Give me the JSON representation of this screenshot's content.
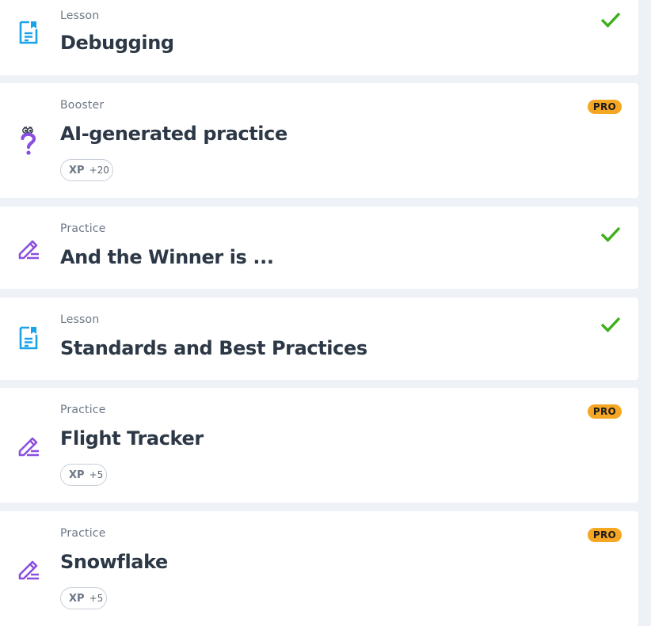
{
  "colors": {
    "background": "#eef2f6",
    "lesson_icon": "#1aa3e8",
    "practice_icon": "#8a4fe0",
    "check": "#3cb01a",
    "pro_badge": "#f5a623"
  },
  "items": [
    {
      "kind": "Lesson",
      "title": "Debugging",
      "icon": "lesson-doc-icon",
      "status": "completed"
    },
    {
      "kind": "Booster",
      "title": "AI-generated practice",
      "icon": "question-mark-icon",
      "badge": "PRO",
      "xp_label": "XP",
      "xp_value": "+20"
    },
    {
      "kind": "Practice",
      "title": "And the Winner is ...",
      "icon": "pencil-icon",
      "status": "completed"
    },
    {
      "kind": "Lesson",
      "title": "Standards and Best Practices",
      "icon": "lesson-doc-icon",
      "status": "completed"
    },
    {
      "kind": "Practice",
      "title": "Flight Tracker",
      "icon": "pencil-icon",
      "badge": "PRO",
      "xp_label": "XP",
      "xp_value": "+5"
    },
    {
      "kind": "Practice",
      "title": "Snowflake",
      "icon": "pencil-icon",
      "badge": "PRO",
      "xp_label": "XP",
      "xp_value": "+5"
    }
  ]
}
